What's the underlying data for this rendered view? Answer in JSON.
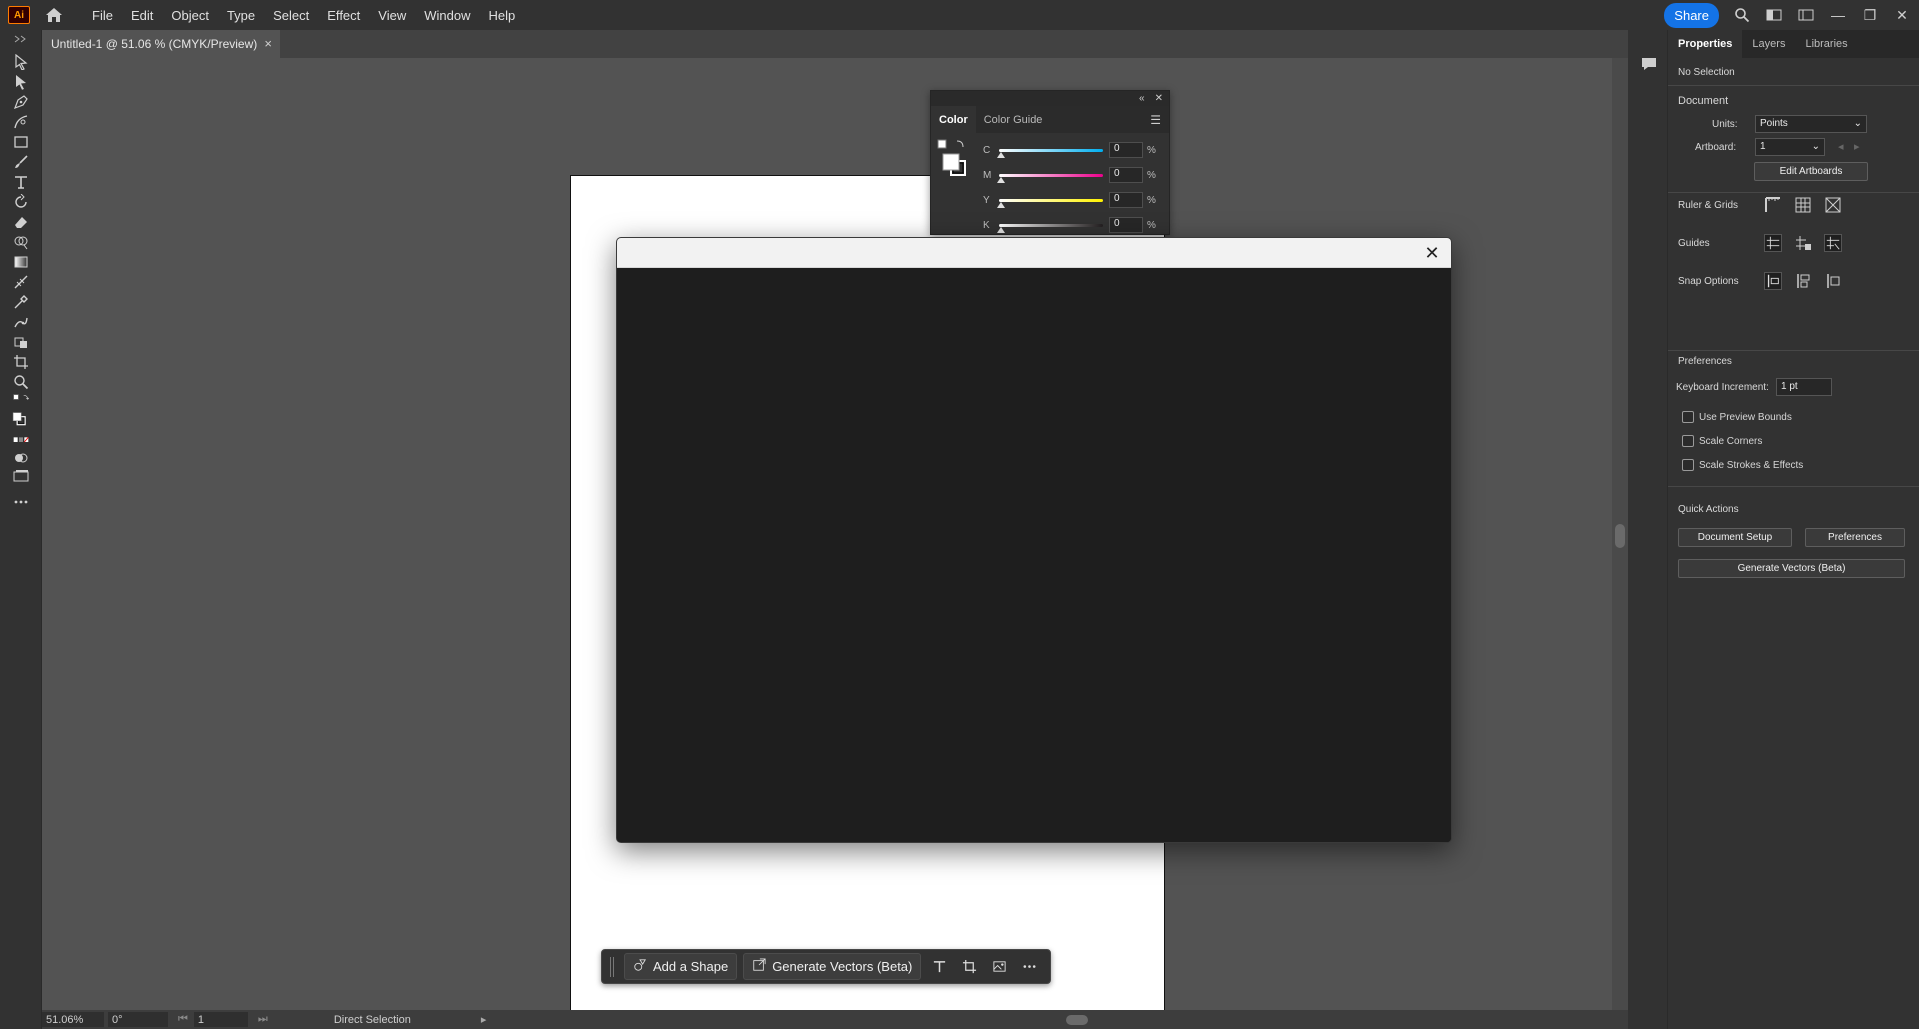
{
  "app": {
    "logo": "Ai",
    "home_icon": "home-icon"
  },
  "menu": [
    "File",
    "Edit",
    "Object",
    "Type",
    "Select",
    "Effect",
    "View",
    "Window",
    "Help"
  ],
  "menubar_right": {
    "share_label": "Share"
  },
  "document_tab": {
    "title": "Untitled-1 @ 51.06 % (CMYK/Preview)",
    "close": "×"
  },
  "color_panel": {
    "tabs": [
      "Color",
      "Color Guide"
    ],
    "sliders": [
      {
        "label": "C",
        "value": "0",
        "unit": "%",
        "gradient": "linear-gradient(to right,#ffffff,#00aeef)"
      },
      {
        "label": "M",
        "value": "0",
        "unit": "%",
        "gradient": "linear-gradient(to right,#ffffff,#ec008c)"
      },
      {
        "label": "Y",
        "value": "0",
        "unit": "%",
        "gradient": "linear-gradient(to right,#ffffff,#fff200)"
      },
      {
        "label": "K",
        "value": "0",
        "unit": "%",
        "gradient": "linear-gradient(to right,#ffffff,#231f20)"
      }
    ]
  },
  "dialog": {
    "close": "✕"
  },
  "taskbar": {
    "add_shape": "Add a Shape",
    "generate_vectors": "Generate Vectors (Beta)"
  },
  "statusbar": {
    "zoom": "51.06%",
    "rotation": "0°",
    "artboard": "1",
    "tool": "Direct Selection"
  },
  "properties": {
    "tabs": [
      "Properties",
      "Layers",
      "Libraries"
    ],
    "selection": "No Selection",
    "document": {
      "title": "Document",
      "units_label": "Units:",
      "units_value": "Points",
      "artboard_label": "Artboard:",
      "artboard_value": "1",
      "edit_artboards": "Edit Artboards"
    },
    "ruler_grids": "Ruler & Grids",
    "guides": "Guides",
    "snap_options": "Snap Options",
    "preferences": {
      "title": "Preferences",
      "keyboard_increment_label": "Keyboard Increment:",
      "keyboard_increment_value": "1 pt",
      "use_preview_bounds": "Use Preview Bounds",
      "scale_corners": "Scale Corners",
      "scale_strokes": "Scale Strokes & Effects"
    },
    "quick_actions": {
      "title": "Quick Actions",
      "document_setup": "Document Setup",
      "preferences": "Preferences",
      "generate_vectors": "Generate Vectors (Beta)"
    }
  }
}
